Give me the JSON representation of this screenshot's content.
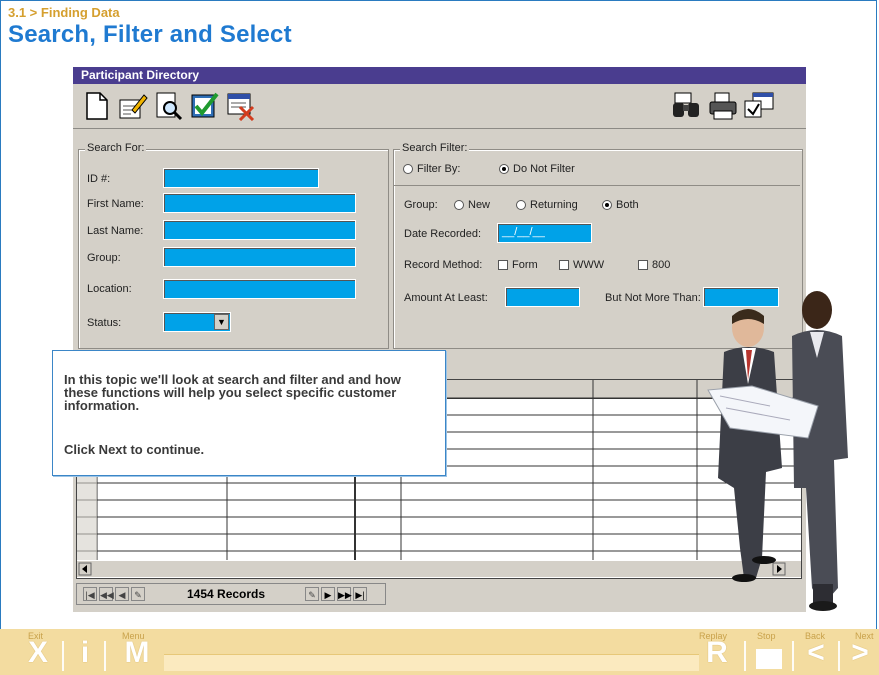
{
  "header": {
    "breadcrumb": "3.1 > Finding Data",
    "title": "Search, Filter and Select"
  },
  "window": {
    "title": "Participant Directory"
  },
  "toolbar": {
    "left_icons": [
      "new-document-icon",
      "edit-icon",
      "preview-search-icon",
      "approve-icon",
      "delete-record-icon"
    ],
    "right_icons": [
      "binoculars-find-icon",
      "printer-icon",
      "properties-icon"
    ]
  },
  "search_for": {
    "legend": "Search For:",
    "id_label": "ID #:",
    "first_name_label": "First Name:",
    "last_name_label": "Last Name:",
    "group_label": "Group:",
    "location_label": "Location:",
    "status_label": "Status:"
  },
  "search_filter": {
    "legend": "Search Filter:",
    "filter_by": "Filter By:",
    "do_not_filter": "Do Not Filter",
    "group_label": "Group:",
    "group_new": "New",
    "group_returning": "Returning",
    "group_both": "Both",
    "date_recorded_label": "Date Recorded:",
    "date_placeholder": "__/__/__",
    "record_method_label": "Record Method:",
    "method_form": "Form",
    "method_www": "WWW",
    "method_800": "800",
    "amount_least_label": "Amount At Least:",
    "amount_most_label": "But Not More Than:"
  },
  "records": {
    "count_label": "1454 Records"
  },
  "popup": {
    "text": "In this topic we'll look at search and filter and and how these functions will help you select specific customer information.",
    "next_text": "Click Next to continue."
  },
  "bottom_bar": {
    "exit_caption": "Exit",
    "exit_glyph": "X",
    "info_glyph": "i",
    "menu_caption": "Menu",
    "menu_glyph": "M",
    "replay_caption": "Replay",
    "replay_glyph": "R",
    "stop_caption": "Stop",
    "back_caption": "Back",
    "back_glyph": "<",
    "next_caption": "Next",
    "next_glyph": ">"
  },
  "colors": {
    "field_fill": "#00a2e8",
    "title_bar": "#4a3d8f",
    "heading_blue": "#1f7ad1",
    "breadcrumb_gold": "#d59f2e"
  }
}
